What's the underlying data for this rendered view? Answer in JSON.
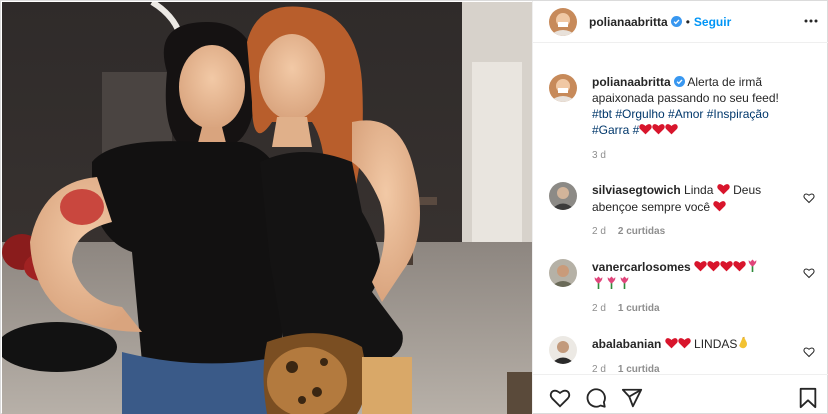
{
  "post": {
    "username": "polianaabritta",
    "follow_label": "Seguir",
    "separator": "•"
  },
  "caption": {
    "username": "polianaabritta",
    "text": "Alerta de irmã apaixonada passando no seu feed!",
    "hashtags": "#tbt #Orgulho #Amor #Inspiração #Garra #",
    "time": "3 d"
  },
  "comments": [
    {
      "username": "silviasegtowich",
      "text_a": "Linda",
      "text_b": "Deus abençoe sempre você",
      "time": "2 d",
      "likes": "2 curtidas"
    },
    {
      "username": "vanercarlosomes",
      "time": "2 d",
      "likes": "1 curtida"
    },
    {
      "username": "abalabanian",
      "text": "LINDAS",
      "time": "2 d",
      "likes": "1 curtida"
    }
  ],
  "colors": {
    "accent": "#0095f6",
    "heart": "#ed4956",
    "verified": "#3897f0",
    "tag": "#00376b"
  },
  "icons": [
    "verified-badge-icon",
    "more-options-icon",
    "heart-icon",
    "comment-icon",
    "share-icon",
    "bookmark-icon"
  ]
}
